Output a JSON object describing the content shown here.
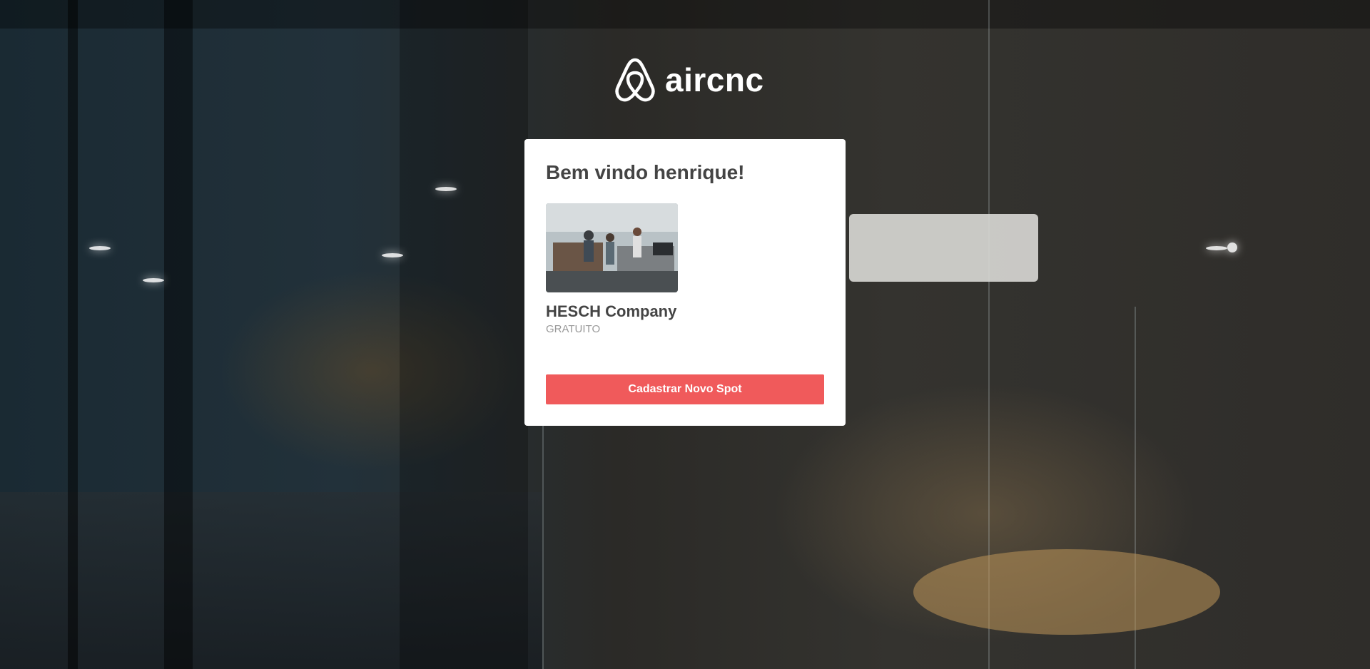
{
  "brand": {
    "name": "aircnc",
    "icon": "airbnb-logo-icon"
  },
  "card": {
    "title": "Bem vindo henrique!",
    "spots": [
      {
        "name": "HESCH Company",
        "price": "GRATUITO",
        "thumbnail": "office-photo"
      }
    ],
    "new_spot_label": "Cadastrar Novo Spot"
  },
  "colors": {
    "accent": "#f05a5b",
    "title": "#444444",
    "price": "#999999"
  }
}
